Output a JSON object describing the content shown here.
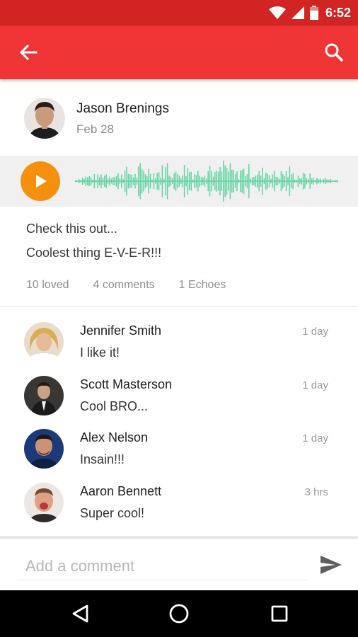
{
  "status_bar": {
    "time": "6:52",
    "icons": [
      "wifi-icon",
      "cell-signal-icon",
      "battery-icon"
    ]
  },
  "app_bar": {
    "back_icon": "arrow-left-icon",
    "search_icon": "search-icon"
  },
  "post": {
    "author": "Jason Brenings",
    "date": "Feb 28",
    "text_lines": [
      "Check this out...",
      "Coolest thing E-V-E-R!!!"
    ],
    "stats": {
      "loved": "10 loved",
      "comments": "4 comments",
      "echoes": "1 Echoes"
    }
  },
  "audio": {
    "play_icon": "play-icon"
  },
  "comments": [
    {
      "name": "Jennifer Smith",
      "text": "I like it!",
      "time": "1 day"
    },
    {
      "name": "Scott Masterson",
      "text": "Cool BRO...",
      "time": "1 day"
    },
    {
      "name": "Alex Nelson",
      "text": "Insain!!!",
      "time": "1 day"
    },
    {
      "name": "Aaron Bennett",
      "text": "Super cool!",
      "time": "3 hrs"
    }
  ],
  "composer": {
    "placeholder": "Add a comment",
    "send_icon": "send-icon"
  },
  "nav_bar": {
    "icons": [
      "back-triangle-icon",
      "home-circle-icon",
      "recents-square-icon"
    ]
  },
  "colors": {
    "status_bar": "#d32424",
    "app_bar": "#ef3535",
    "play_button": "#f5900f",
    "waveform": "#5fd3a0",
    "audio_background": "#f0f0f0"
  }
}
